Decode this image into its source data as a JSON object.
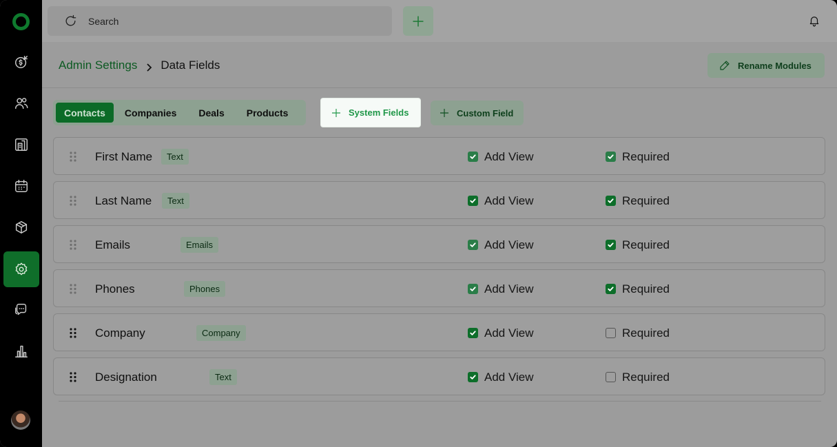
{
  "search": {
    "label": "Search"
  },
  "breadcrumb": {
    "parent": "Admin Settings",
    "current": "Data Fields"
  },
  "header": {
    "rename_label": "Rename Modules"
  },
  "tabs": [
    {
      "label": "Contacts",
      "active": true
    },
    {
      "label": "Companies",
      "active": false
    },
    {
      "label": "Deals",
      "active": false
    },
    {
      "label": "Products",
      "active": false
    }
  ],
  "actions": {
    "system_fields": "System Fields",
    "custom_field": "Custom Field"
  },
  "fields": [
    {
      "name": "First Name",
      "type": "Text",
      "add_view": true,
      "required": true,
      "add_view_label": "Add View",
      "required_label": "Required"
    },
    {
      "name": "Last Name",
      "type": "Text",
      "add_view": true,
      "required": true,
      "add_view_label": "Add View",
      "required_label": "Required"
    },
    {
      "name": "Emails",
      "type": "Emails",
      "add_view": true,
      "required": true,
      "add_view_label": "Add View",
      "required_label": "Required"
    },
    {
      "name": "Phones",
      "type": "Phones",
      "add_view": true,
      "required": true,
      "add_view_label": "Add View",
      "required_label": "Required"
    },
    {
      "name": "Company",
      "type": "Company",
      "add_view": true,
      "required": false,
      "add_view_label": "Add View",
      "required_label": "Required"
    },
    {
      "name": "Designation",
      "type": "Text",
      "add_view": true,
      "required": false,
      "add_view_label": "Add View",
      "required_label": "Required"
    }
  ],
  "icons": {
    "sidebar": [
      "deals-icon",
      "contacts-icon",
      "companies-icon",
      "calendar-icon",
      "products-icon",
      "settings-icon",
      "chat-icon",
      "reports-icon"
    ],
    "accent": "#0b6b27"
  }
}
